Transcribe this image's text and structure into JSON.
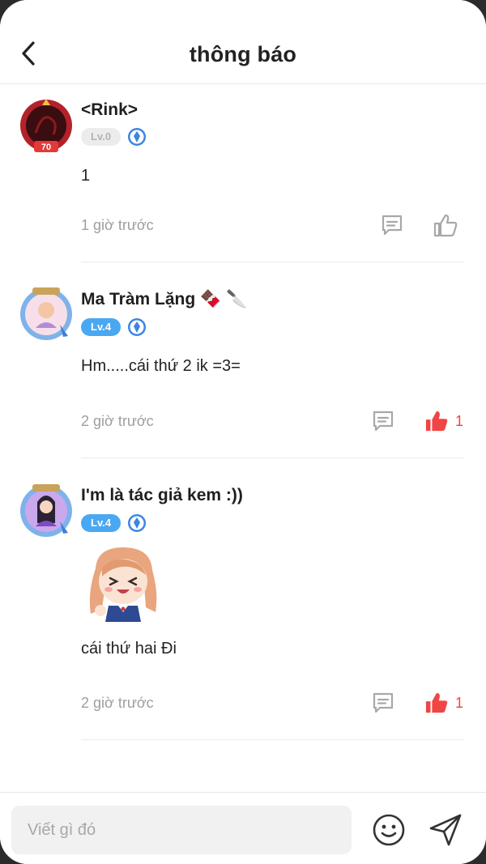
{
  "header": {
    "title": "thông báo",
    "back_icon": "chevron-left-icon"
  },
  "comments": [
    {
      "username": "<Rink>",
      "level": "Lv.0",
      "text": "1",
      "time": "1 giờ trước",
      "liked": false,
      "likes": ""
    },
    {
      "username": "Ma Tràm Lặng 🍫 🔪",
      "level": "Lv.4",
      "text": "Hm.....cái thứ 2 ik =3=",
      "time": "2 giờ trước",
      "liked": true,
      "likes": "1"
    },
    {
      "username": "I'm là tác giả kem :))",
      "level": "Lv.4",
      "sticker": "anime-girl-sticker",
      "text": "cái thứ hai Đi",
      "time": "2 giờ trước",
      "liked": true,
      "likes": "1"
    }
  ],
  "composer": {
    "placeholder": "Viết gì đó",
    "emoji_icon": "smiley-icon",
    "send_icon": "send-icon"
  },
  "colors": {
    "accent_blue": "#4aa8f2",
    "like_red": "#f04545",
    "muted_text": "#9e9e9e",
    "level0_bg": "#ececec"
  }
}
